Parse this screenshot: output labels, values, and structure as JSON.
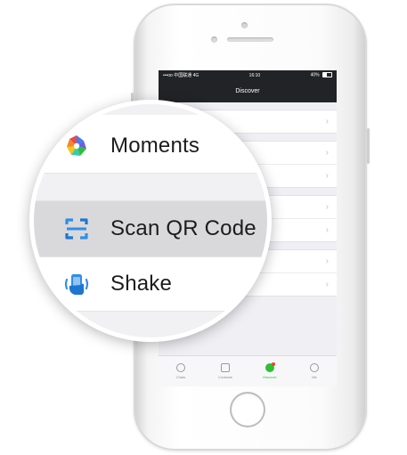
{
  "status_bar": {
    "carrier": "•••oo 中国联通  4G",
    "time": "16:10",
    "battery": "40%"
  },
  "nav": {
    "title": "Discover"
  },
  "tab_bar": {
    "items": [
      {
        "label": "Chats",
        "icon": "chat-bubble-icon",
        "active": false
      },
      {
        "label": "Contacts",
        "icon": "contacts-icon",
        "active": false
      },
      {
        "label": "Discover",
        "icon": "compass-icon",
        "active": true
      },
      {
        "label": "Me",
        "icon": "person-icon",
        "active": false
      }
    ]
  },
  "magnifier": {
    "items": [
      {
        "label": "Moments",
        "icon": "moments-icon"
      },
      {
        "label": "Scan QR Code",
        "icon": "scan-qr-icon",
        "pressed": true
      },
      {
        "label": "Shake",
        "icon": "shake-icon"
      }
    ]
  },
  "colors": {
    "navbar": "#222326",
    "accent_green": "#2fbf35",
    "pressed_row": "#d9d9dc"
  }
}
